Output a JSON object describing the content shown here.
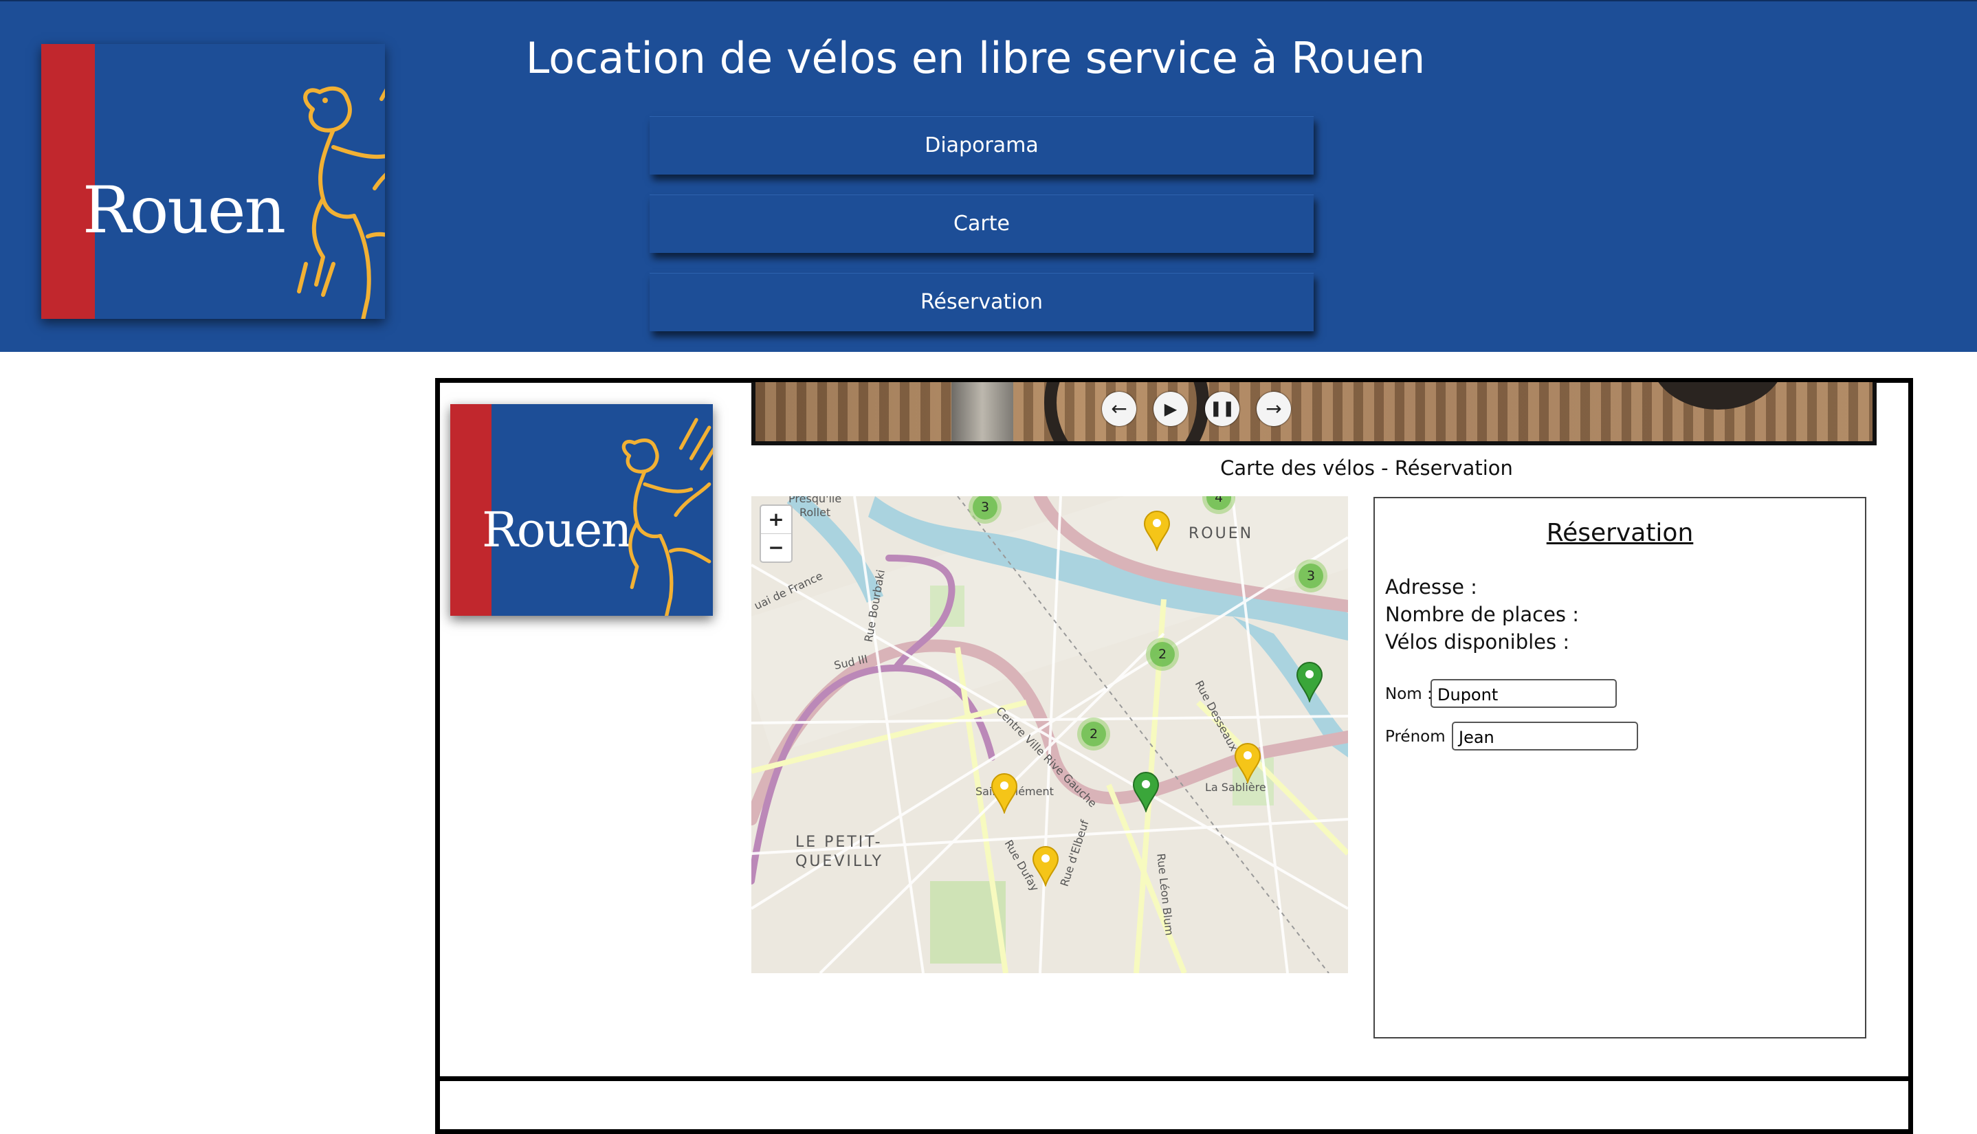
{
  "header": {
    "title": "Location de vélos en libre service à Rouen",
    "logo_text": "Rouen",
    "nav": [
      "Diaporama",
      "Carte",
      "Réservation"
    ]
  },
  "slider": {
    "controls": [
      "previous-icon",
      "play-icon",
      "pause-icon",
      "next-icon"
    ]
  },
  "main": {
    "section_title": "Carte des vélos - Réservation",
    "logo_text": "Rouen"
  },
  "map": {
    "zoom_in": "+",
    "zoom_out": "−",
    "labels": [
      "ROUEN",
      "LE PETIT-",
      "QUEVILLY",
      "Rue Bourbaki",
      "Sud III",
      "uai de France",
      "Presqu'île",
      "Rollet",
      "La Sablière",
      "Rue Desseaux",
      "Rue Dufay",
      "Rue d'Elbeuf",
      "Rue Léon Blum",
      "Centre Ville Rive Gauche",
      "Saint-Clément"
    ],
    "clusters": [
      "3",
      "4",
      "3",
      "2",
      "2"
    ],
    "marker_colors": {
      "available": "#3aa63a",
      "low": "#f5c518"
    }
  },
  "reservation": {
    "title": "Réservation",
    "address_label": "Adresse :",
    "places_label": "Nombre de places :",
    "bikes_label": "Vélos disponibles :",
    "nom_label": "Nom :",
    "nom_value": "Dupont",
    "prenom_label": "Prénom :",
    "prenom_value": "Jean"
  },
  "colors": {
    "brand_blue": "#1d4e97",
    "brand_red": "#c1272d",
    "lion_gold": "#f2b134"
  }
}
